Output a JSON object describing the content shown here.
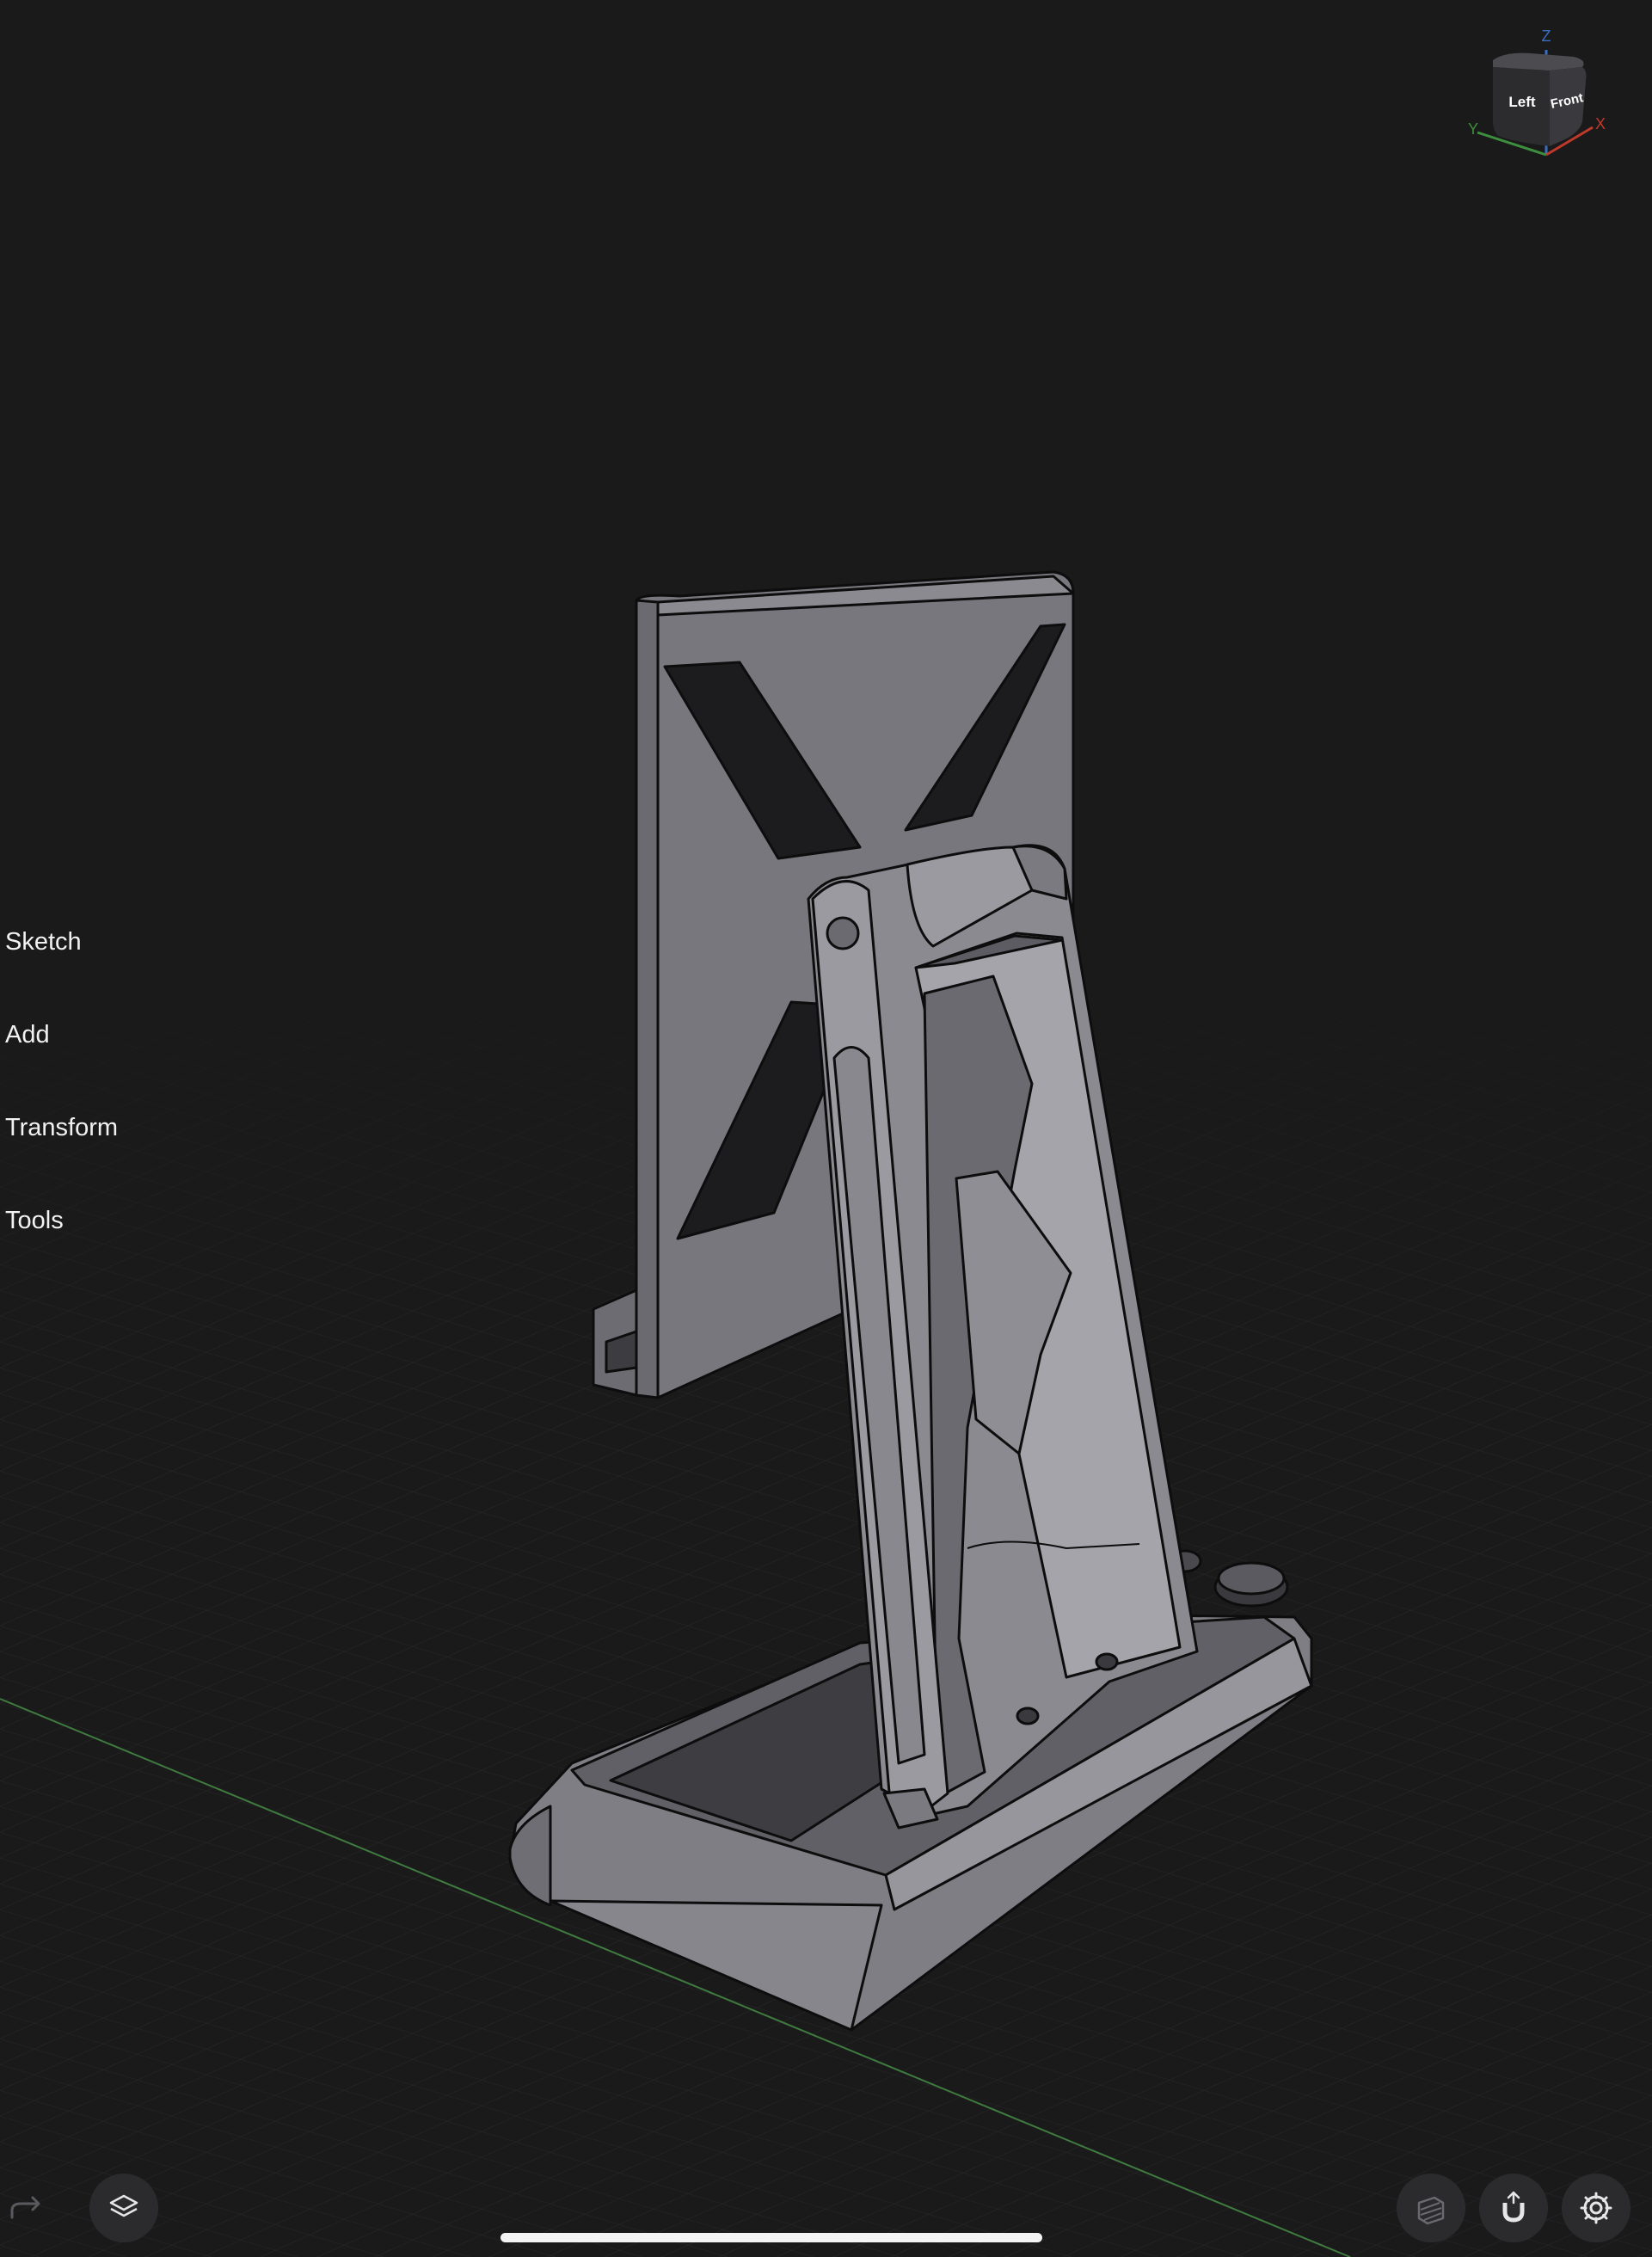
{
  "left_menu": {
    "items": [
      "Sketch",
      "Add",
      "Transform",
      "Tools"
    ]
  },
  "view_cube": {
    "left_label": "Left",
    "front_label": "Front",
    "axis_z": "Z",
    "axis_y": "Y",
    "axis_x": "X",
    "axis_colors": {
      "x": "#c0392b",
      "y": "#3d8f3d",
      "z": "#3a6fbf"
    }
  },
  "bottom_toolbar": {
    "left": [
      "redo-icon",
      "layers-icon"
    ],
    "right": [
      "display-mode-icon",
      "snap-magnet-icon",
      "settings-gear-icon"
    ]
  },
  "colors": {
    "background": "#1a1a1b",
    "grid": "#2a2a2c",
    "ground_axis": "#3f7a3f",
    "model_fill": "#7a7a80"
  }
}
